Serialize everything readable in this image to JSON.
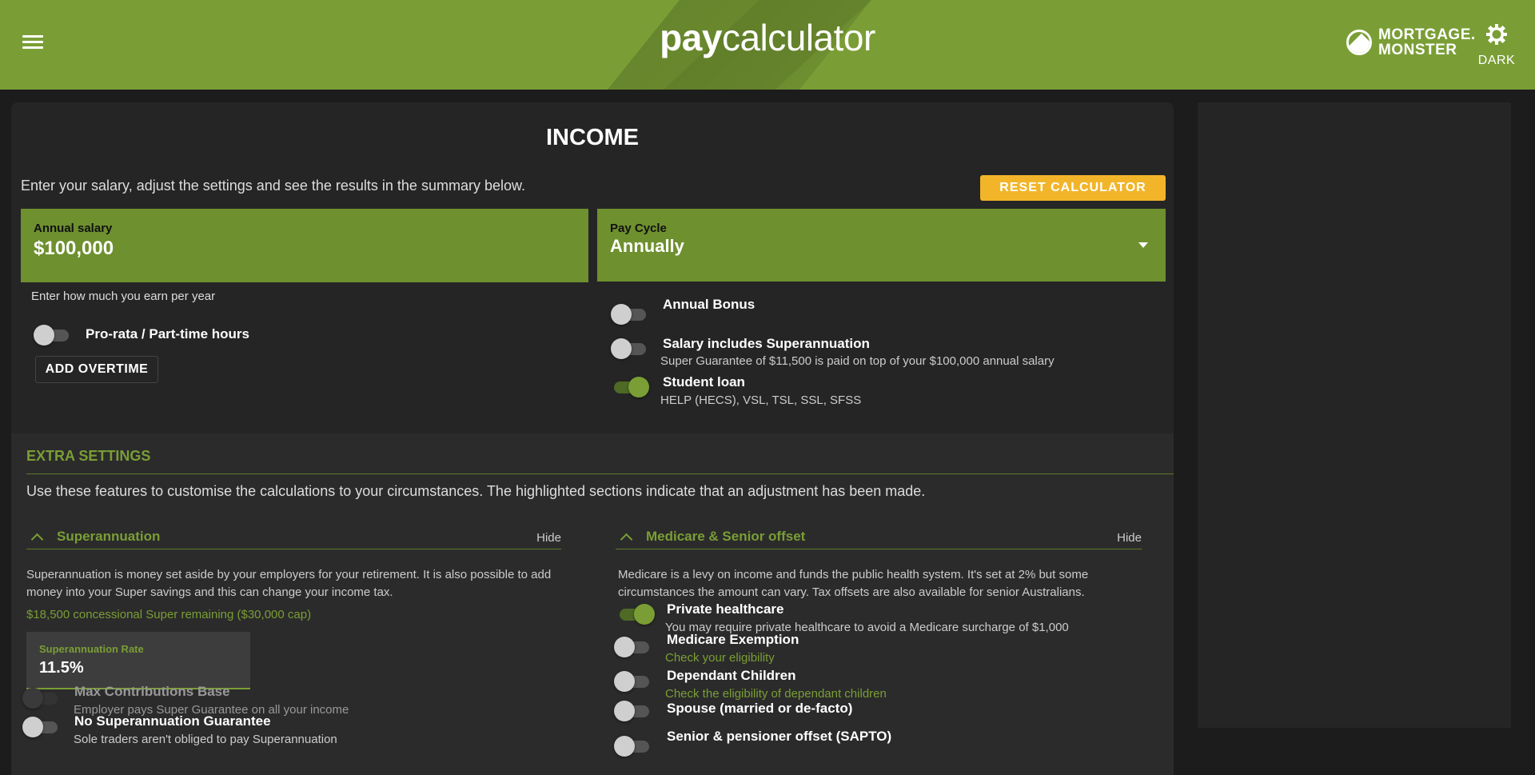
{
  "header": {
    "logo_bold": "pay",
    "logo_light": "calculator",
    "partner_line1": "MORTGAGE.",
    "partner_line2": "MONSTER",
    "theme_label": "DARK"
  },
  "income": {
    "title": "INCOME",
    "intro": "Enter your salary, adjust the settings and see the results in the summary below.",
    "reset_label": "RESET CALCULATOR",
    "salary_label": "Annual salary",
    "salary_value": "$100,000",
    "salary_helper": "Enter how much you earn per year",
    "paycycle_label": "Pay Cycle",
    "paycycle_value": "Annually",
    "prorata_label": "Pro-rata / Part-time hours",
    "overtime_label": "ADD OVERTIME",
    "bonus_label": "Annual Bonus",
    "super_incl_label": "Salary includes Superannuation",
    "super_incl_sub": "Super Guarantee of $11,500 is paid on top of your $100,000 annual salary",
    "student_label": "Student loan",
    "student_sub": "HELP (HECS), VSL, TSL, SSL, SFSS"
  },
  "toggles": {
    "prorata": false,
    "bonus": false,
    "super_incl": false,
    "student": true,
    "private_health": true,
    "medicare_exempt": false,
    "dependants": false,
    "spouse": false,
    "sapto": false,
    "max_contrib": false,
    "no_super": false
  },
  "extra": {
    "title": "EXTRA SETTINGS",
    "desc": "Use these features to customise the calculations to your circumstances. The highlighted sections indicate that an adjustment has been made.",
    "super": {
      "title": "Superannuation",
      "hide": "Hide",
      "para": "Superannuation is money set aside by your employers for your retirement. It is also possible to add money into your Super savings and this can change your income tax.",
      "remaining": "$18,500 concessional Super remaining ($30,000 cap)",
      "rate_label": "Superannuation Rate",
      "rate_value": "11.5%",
      "max_label": "Max Contributions Base",
      "max_sub": "Employer pays Super Guarantee on all your income",
      "nosuper_label": "No Superannuation Guarantee",
      "nosuper_sub": "Sole traders aren't obliged to pay Superannuation"
    },
    "medicare": {
      "title": "Medicare & Senior offset",
      "hide": "Hide",
      "para": "Medicare is a levy on income and funds the public health system. It's set at 2% but some circumstances the amount can vary. Tax offsets are also available for senior Australians.",
      "private_label": "Private healthcare",
      "private_sub": "You may require private healthcare to avoid a Medicare surcharge of $1,000",
      "exempt_label": "Medicare Exemption",
      "exempt_sub": "Check your eligibility",
      "dependant_label": "Dependant Children",
      "dependant_sub": "Check the eligibility of dependant children",
      "spouse_label": "Spouse (married or de-facto)",
      "sapto_label": "Senior & pensioner offset (SAPTO)"
    }
  }
}
